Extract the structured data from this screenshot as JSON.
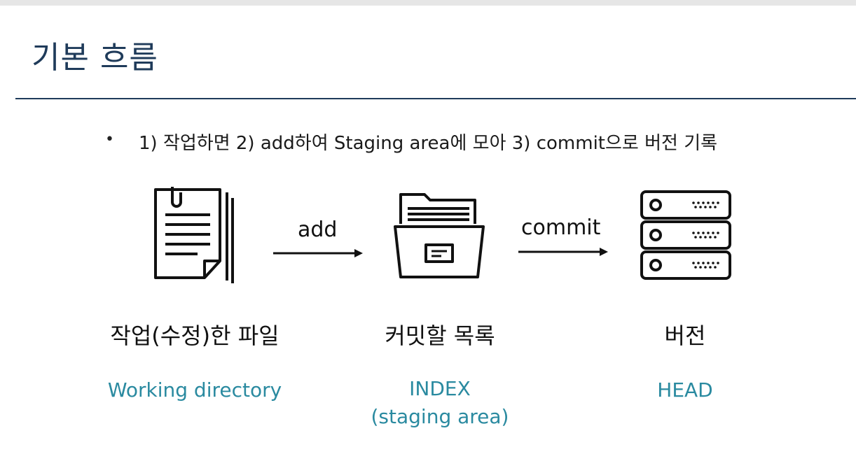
{
  "slide": {
    "title": "기본 흐름",
    "bullet_text": "1) 작업하면 2) add하여 Staging area에 모아 3) commit으로 버전 기록"
  },
  "diagram": {
    "arrows": [
      {
        "label": "add"
      },
      {
        "label": "commit"
      }
    ],
    "stages": [
      {
        "icon": "document-icon",
        "kr_label": "작업(수정)한 파일",
        "en_label": "Working directory"
      },
      {
        "icon": "folder-icon",
        "kr_label": "커밋할 목록",
        "en_label_line1": "INDEX",
        "en_label_line2": "(staging area)"
      },
      {
        "icon": "server-icon",
        "kr_label": "버전",
        "en_label": "HEAD"
      }
    ]
  },
  "colors": {
    "title": "#1f3b5a",
    "accent_label": "#2a8aa0",
    "icon_stroke": "#111111"
  }
}
